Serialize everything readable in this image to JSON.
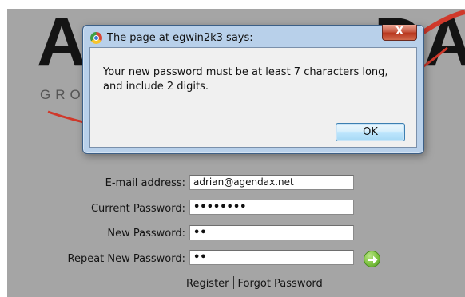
{
  "background": {
    "logo_initial": "A",
    "logo_right": "DA",
    "logo_tagline": "GRO"
  },
  "dialog": {
    "title": "The page at egwin2k3 says:",
    "close_label": "X",
    "message": "Your new password must be at least 7 characters long, and include 2 digits.",
    "ok_label": "OK"
  },
  "form": {
    "email_label": "E-mail address:",
    "email_value": "adrian@agendax.net",
    "current_password_label": "Current Password:",
    "current_password_value": "••••••••",
    "new_password_label": "New Password:",
    "new_password_value": "••",
    "repeat_password_label": "Repeat New Password:",
    "repeat_password_value": "••"
  },
  "links": {
    "register": "Register",
    "forgot_password": "Forgot Password"
  },
  "colors": {
    "page_background": "#a5a5a5",
    "dialog_frame": "#b8d0ea",
    "go_button": "#7fc342",
    "accent_red": "#d0392b"
  }
}
